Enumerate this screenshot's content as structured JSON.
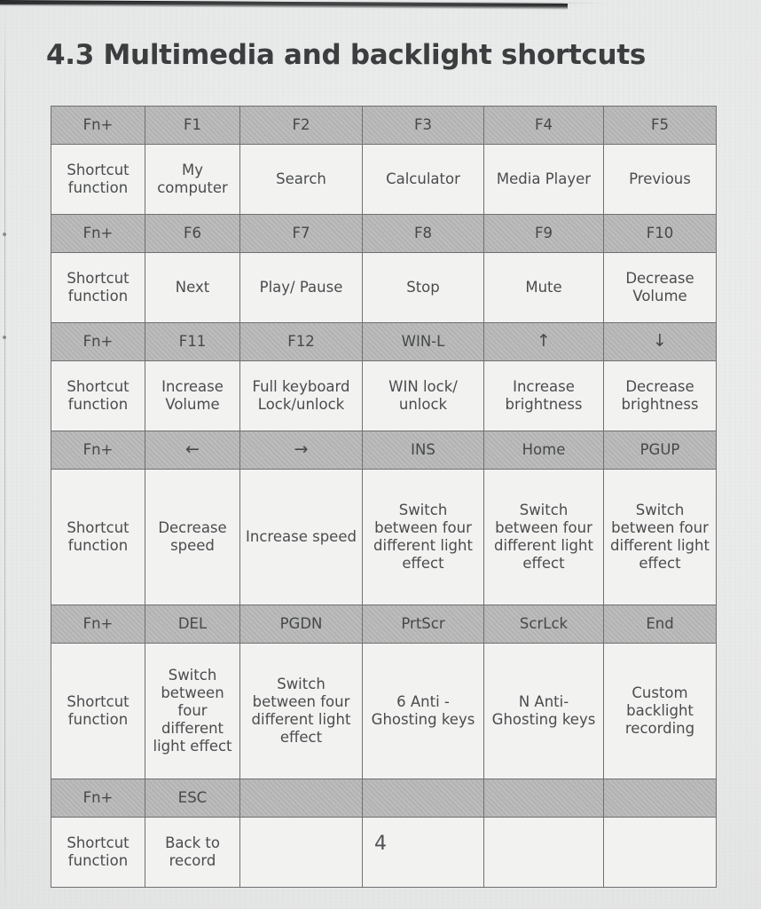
{
  "document": {
    "heading": "4.3 Multimedia and backlight shortcuts",
    "page_number": "4"
  },
  "table": {
    "row_label": "Shortcut function",
    "fn_label": "Fn+",
    "blocks": [
      {
        "keys": [
          "Fn+",
          "F1",
          "F2",
          "F3",
          "F4",
          "F5"
        ],
        "functions": [
          "Shortcut function",
          "My computer",
          "Search",
          "Calculator",
          "Media Player",
          "Previous"
        ]
      },
      {
        "keys": [
          "Fn+",
          "F6",
          "F7",
          "F8",
          "F9",
          "F10"
        ],
        "functions": [
          "Shortcut function",
          "Next",
          "Play/ Pause",
          "Stop",
          "Mute",
          "Decrease Volume"
        ]
      },
      {
        "keys": [
          "Fn+",
          "F11",
          "F12",
          "WIN-L",
          "↑",
          "↓"
        ],
        "functions": [
          "Shortcut function",
          "Increase Volume",
          "Full keyboard Lock/unlock",
          "WIN lock/ unlock",
          "Increase brightness",
          "Decrease brightness"
        ]
      },
      {
        "keys": [
          "Fn+",
          "←",
          "→",
          "INS",
          "Home",
          "PGUP"
        ],
        "functions": [
          "Shortcut function",
          "Decrease speed",
          "Increase speed",
          "Switch between four different light effect",
          "Switch between four different light effect",
          "Switch between four different light effect"
        ]
      },
      {
        "keys": [
          "Fn+",
          "DEL",
          "PGDN",
          "PrtScr",
          "ScrLck",
          "End"
        ],
        "functions": [
          "Shortcut function",
          "Switch between four different light effect",
          "Switch between four different light effect",
          "6 Anti -Ghosting keys",
          "N Anti- Ghosting keys",
          "Custom backlight recording"
        ]
      },
      {
        "keys": [
          "Fn+",
          "ESC"
        ],
        "functions": [
          "Shortcut function",
          "Back to record"
        ]
      }
    ]
  },
  "colors": {
    "paper": "#e9eaea",
    "cell_background": "#f2f2f1",
    "key_header_background": "#b4b5b4",
    "border": "#6e7071",
    "text": "#4a4c4d",
    "heading_text": "#3b3d3e"
  }
}
